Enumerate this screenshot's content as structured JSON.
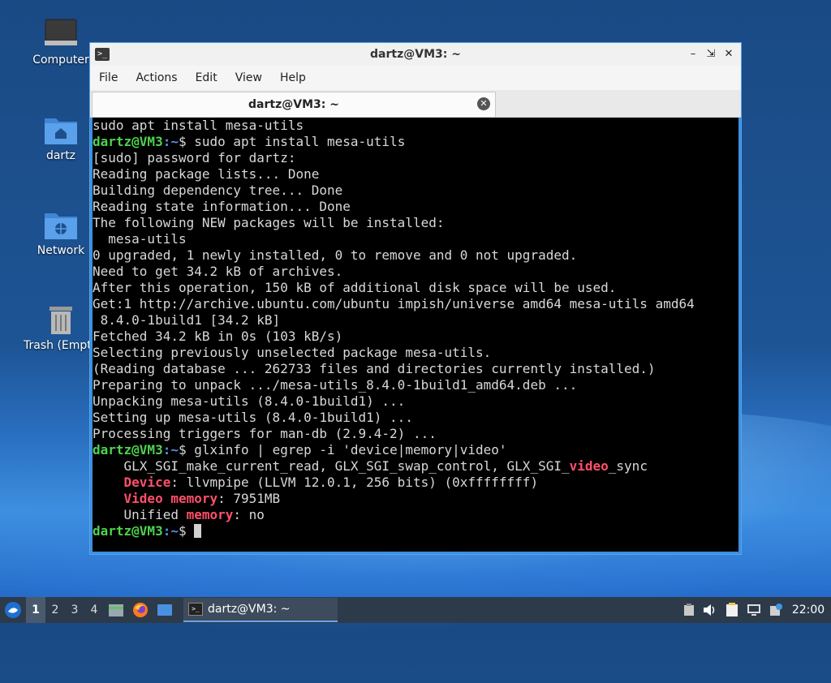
{
  "desktop": {
    "icons": [
      {
        "label": "Computer",
        "icon": "computer-icon"
      },
      {
        "label": "dartz",
        "icon": "home-folder-icon"
      },
      {
        "label": "Network",
        "icon": "network-folder-icon"
      },
      {
        "label": "Trash (Empty)",
        "icon": "trash-icon"
      }
    ]
  },
  "window": {
    "title": "dartz@VM3: ~",
    "menu": [
      "File",
      "Actions",
      "Edit",
      "View",
      "Help"
    ],
    "tab_label": "dartz@VM3: ~"
  },
  "terminal": {
    "prompt_user": "dartz@VM3",
    "prompt_path": ":~",
    "prompt_symbol": "$",
    "lines": [
      {
        "t": "plain",
        "text": "sudo apt install mesa-utils"
      },
      {
        "t": "prompt",
        "cmd": " sudo apt install mesa-utils"
      },
      {
        "t": "plain",
        "text": "[sudo] password for dartz:"
      },
      {
        "t": "plain",
        "text": "Reading package lists... Done"
      },
      {
        "t": "plain",
        "text": "Building dependency tree... Done"
      },
      {
        "t": "plain",
        "text": "Reading state information... Done"
      },
      {
        "t": "plain",
        "text": "The following NEW packages will be installed:"
      },
      {
        "t": "plain",
        "text": "  mesa-utils"
      },
      {
        "t": "plain",
        "text": "0 upgraded, 1 newly installed, 0 to remove and 0 not upgraded."
      },
      {
        "t": "plain",
        "text": "Need to get 34.2 kB of archives."
      },
      {
        "t": "plain",
        "text": "After this operation, 150 kB of additional disk space will be used."
      },
      {
        "t": "plain",
        "text": "Get:1 http://archive.ubuntu.com/ubuntu impish/universe amd64 mesa-utils amd64"
      },
      {
        "t": "plain",
        "text": " 8.4.0-1build1 [34.2 kB]"
      },
      {
        "t": "plain",
        "text": "Fetched 34.2 kB in 0s (103 kB/s)"
      },
      {
        "t": "plain",
        "text": "Selecting previously unselected package mesa-utils."
      },
      {
        "t": "plain",
        "text": "(Reading database ... 262733 files and directories currently installed.)"
      },
      {
        "t": "plain",
        "text": "Preparing to unpack .../mesa-utils_8.4.0-1build1_amd64.deb ..."
      },
      {
        "t": "plain",
        "text": "Unpacking mesa-utils (8.4.0-1build1) ..."
      },
      {
        "t": "plain",
        "text": "Setting up mesa-utils (8.4.0-1build1) ..."
      },
      {
        "t": "plain",
        "text": "Processing triggers for man-db (2.9.4-2) ..."
      },
      {
        "t": "prompt",
        "cmd": " glxinfo | egrep -i 'device|memory|video'"
      },
      {
        "t": "segs",
        "segs": [
          [
            "n",
            "    GLX_SGI_make_current_read, GLX_SGI_swap_control, GLX_SGI_"
          ],
          [
            "h",
            "video"
          ],
          [
            "n",
            "_sync"
          ]
        ]
      },
      {
        "t": "segs",
        "segs": [
          [
            "n",
            "    "
          ],
          [
            "h",
            "Device"
          ],
          [
            "n",
            ": llvmpipe (LLVM 12.0.1, 256 bits) (0xffffffff)"
          ]
        ]
      },
      {
        "t": "segs",
        "segs": [
          [
            "n",
            "    "
          ],
          [
            "h",
            "Video memory"
          ],
          [
            "n",
            ": 7951MB"
          ]
        ]
      },
      {
        "t": "segs",
        "segs": [
          [
            "n",
            "    Unified "
          ],
          [
            "h",
            "memory"
          ],
          [
            "n",
            ": no"
          ]
        ]
      },
      {
        "t": "prompt",
        "cmd": " ",
        "cursor": true
      }
    ]
  },
  "taskbar": {
    "workspaces": [
      "1",
      "2",
      "3",
      "4"
    ],
    "active_workspace": "1",
    "launchers": [
      "file-manager-icon",
      "firefox-icon",
      "desktop-icon"
    ],
    "task_label": "dartz@VM3: ~",
    "tray": [
      "clipboard-icon",
      "volume-icon",
      "notes-icon",
      "network-icon",
      "update-icon"
    ],
    "clock": "22:00"
  },
  "colors": {
    "prompt_user": "#4fd24f",
    "prompt_path": "#5b8fe8",
    "highlight": "#ff4f6a",
    "window_frame": "#3b8fe0"
  }
}
